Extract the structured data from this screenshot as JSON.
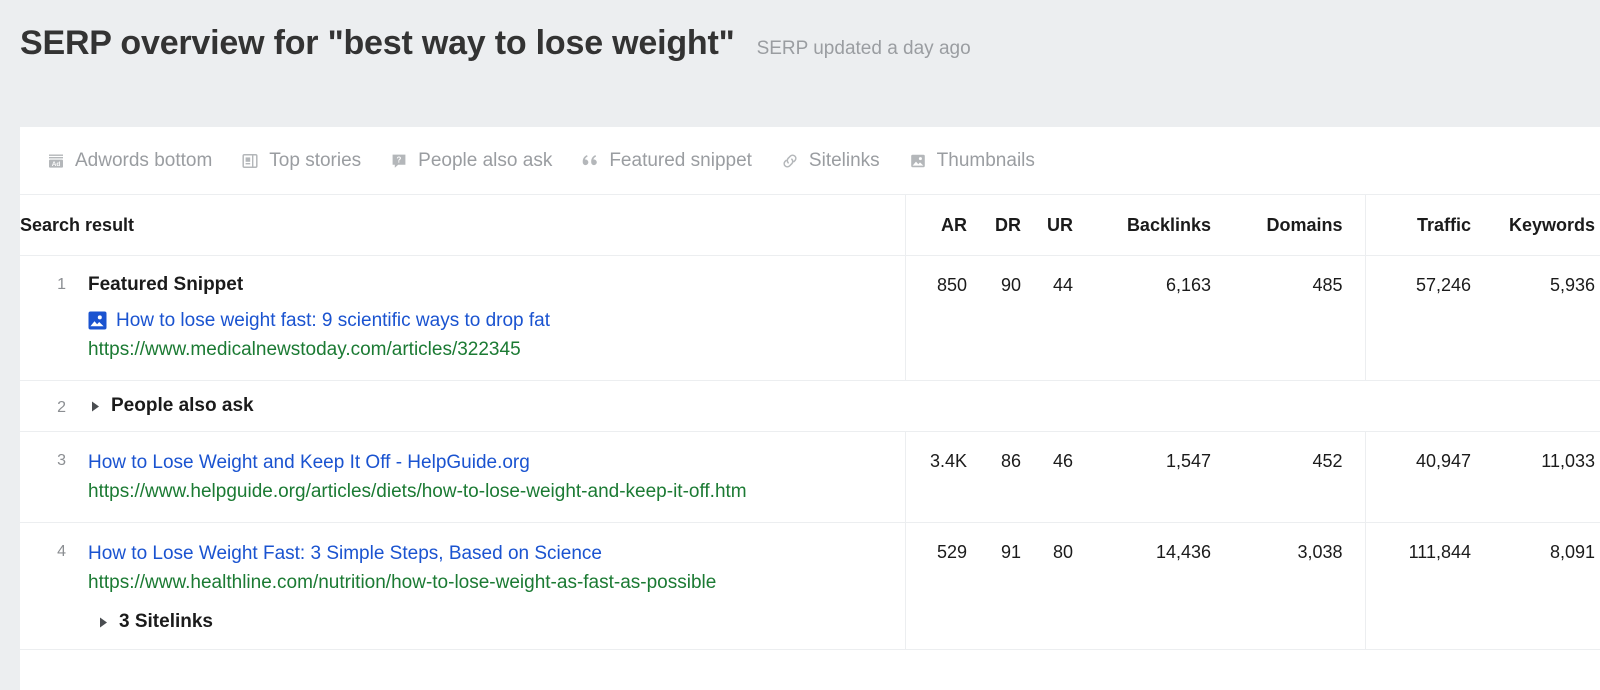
{
  "header": {
    "title": "SERP overview for \"best way to lose weight\"",
    "updated": "SERP updated a day ago"
  },
  "features": [
    {
      "label": "Adwords bottom",
      "icon": "adwords-icon"
    },
    {
      "label": "Top stories",
      "icon": "top-stories-icon"
    },
    {
      "label": "People also ask",
      "icon": "question-box-icon"
    },
    {
      "label": "Featured snippet",
      "icon": "quote-icon"
    },
    {
      "label": "Sitelinks",
      "icon": "link-icon"
    },
    {
      "label": "Thumbnails",
      "icon": "image-icon"
    }
  ],
  "table": {
    "columns": {
      "result": "Search result",
      "ar": "AR",
      "dr": "DR",
      "ur": "UR",
      "backlinks": "Backlinks",
      "domains": "Domains",
      "traffic": "Traffic",
      "keywords": "Keywords"
    },
    "rows": [
      {
        "rank": "1",
        "feature_label": "Featured Snippet",
        "title": "How to lose weight fast: 9 scientific ways to drop fat",
        "url": "https://www.medicalnewstoday.com/articles/322345",
        "icon": "thumbnail-image-icon",
        "ar": "850",
        "dr": "90",
        "ur": "44",
        "backlinks": "6,163",
        "domains": "485",
        "traffic": "57,246",
        "keywords": "5,936"
      },
      {
        "rank": "2",
        "collapsible_label": "People also ask"
      },
      {
        "rank": "3",
        "title": "How to Lose Weight and Keep It Off - HelpGuide.org",
        "url": "https://www.helpguide.org/articles/diets/how-to-lose-weight-and-keep-it-off.htm",
        "ar": "3.4K",
        "dr": "86",
        "ur": "46",
        "backlinks": "1,547",
        "domains": "452",
        "traffic": "40,947",
        "keywords": "11,033"
      },
      {
        "rank": "4",
        "title": "How to Lose Weight Fast: 3 Simple Steps, Based on Science",
        "url": "https://www.healthline.com/nutrition/how-to-lose-weight-as-fast-as-possible",
        "sub_collapsible_label": "3 Sitelinks",
        "ar": "529",
        "dr": "91",
        "ur": "80",
        "backlinks": "14,436",
        "domains": "3,038",
        "traffic": "111,844",
        "keywords": "8,091"
      }
    ]
  },
  "colors": {
    "page_background": "#eceef0",
    "panel_background": "#ffffff",
    "link_blue": "#1a53d0",
    "url_green": "#1b7a33",
    "muted_gray": "#9a9da1",
    "border": "#eceef0"
  }
}
